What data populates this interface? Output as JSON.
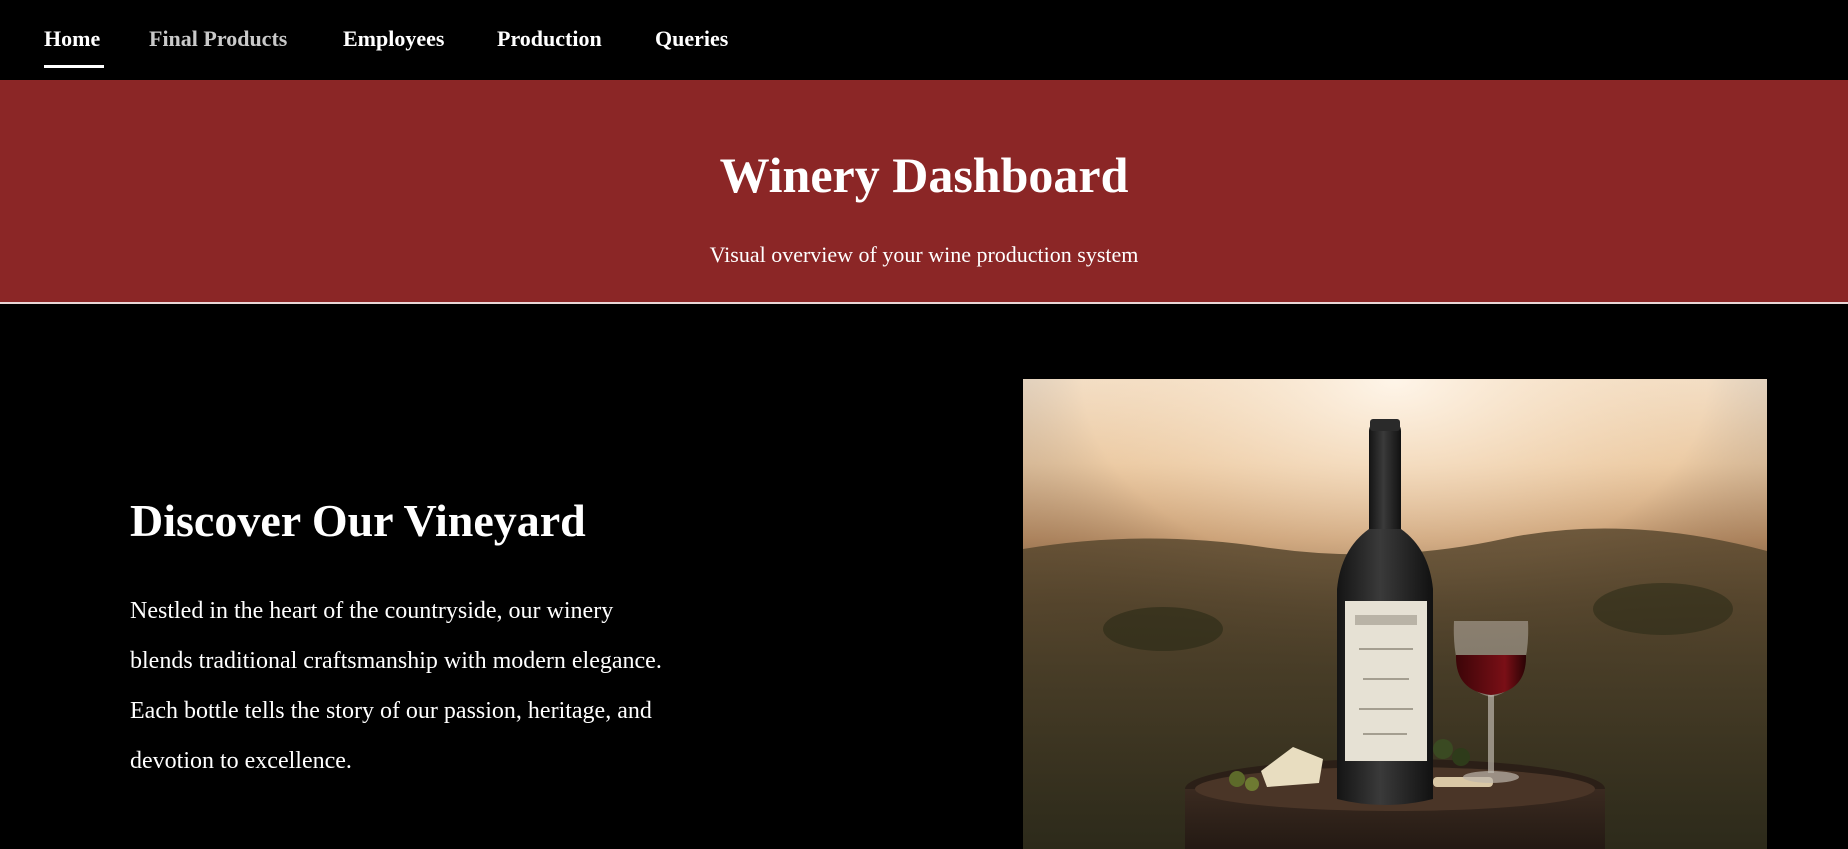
{
  "nav": {
    "items": [
      {
        "label": "Home",
        "active": true
      },
      {
        "label": "Final Products",
        "active": false
      },
      {
        "label": "Employees",
        "active": false
      },
      {
        "label": "Production",
        "active": false
      },
      {
        "label": "Queries",
        "active": false
      }
    ]
  },
  "hero": {
    "title": "Winery Dashboard",
    "subtitle": "Visual overview of your wine production system"
  },
  "section": {
    "title": "Discover Our Vineyard",
    "body": "Nestled in the heart of the countryside, our winery blends traditional craftsmanship with modern elegance. Each bottle tells the story of our passion, heritage, and devotion to excellence."
  },
  "photo": {
    "subject": "wine bottle and glass of red wine on a barrel in a vineyard at sunset"
  },
  "colors": {
    "hero_bg": "#8b2626",
    "page_bg": "#000000",
    "text": "#ffffff",
    "muted_nav": "#c9c9c9"
  }
}
